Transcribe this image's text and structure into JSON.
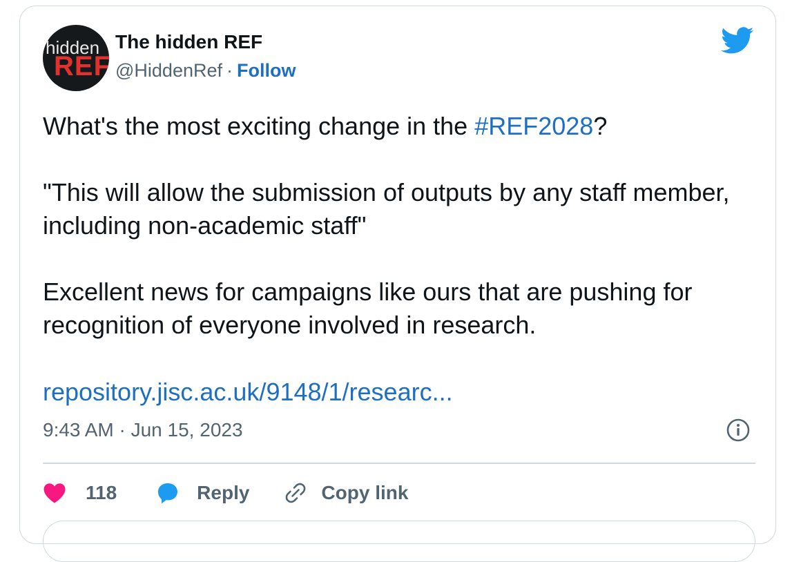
{
  "author": {
    "avatar_text_top": "hidden",
    "avatar_text_bottom": "REF",
    "display_name": "The hidden REF",
    "handle": "@HiddenRef",
    "separator": "·",
    "follow_label": "Follow"
  },
  "tweet": {
    "line1_before": "What's the most exciting change in the ",
    "hashtag": "#REF2028",
    "line1_after": "?",
    "quote": "\"This will allow the submission of outputs by any staff member, including non-academic staff\"",
    "paragraph3": "Excellent news for campaigns like ours that are pushing for recognition of everyone involved in research.",
    "link": "repository.jisc.ac.uk/9148/1/researc...",
    "timestamp": "9:43 AM · Jun 15, 2023"
  },
  "actions": {
    "like_count": "118",
    "reply_label": "Reply",
    "copy_link_label": "Copy link"
  },
  "colors": {
    "accent_blue": "#1d6fc4",
    "twitter_blue": "#1d9bf0",
    "like_red": "#f91880",
    "muted_text": "#536471",
    "border": "#cfd9de"
  },
  "icons": [
    "twitter-bird-icon",
    "info-icon",
    "heart-icon",
    "reply-bubble-icon",
    "link-icon"
  ]
}
